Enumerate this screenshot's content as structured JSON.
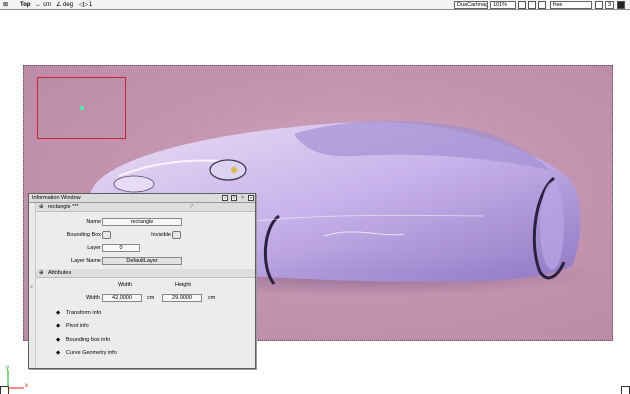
{
  "toolbar": {
    "view_name": "Top",
    "unit": "cm",
    "angle_unit": "deg",
    "snap_value": "1",
    "image_name": "DuaCarImage",
    "zoom": "101%",
    "mode": "free",
    "page_count": "3"
  },
  "info_window": {
    "title": "Information Window",
    "object_header": "rectangle ***",
    "name_label": "Name",
    "name_value": "rectangle",
    "bbox_label": "Bounding Box",
    "invisible_label": "Invisible",
    "layer_label": "Layer",
    "layer_value": "0",
    "layer_name_label": "Layer Name",
    "layer_name_value": "DefaultLayer",
    "attributes_header": "Attributes",
    "width_col": "Width",
    "height_col": "Height",
    "width_label": "Width",
    "width_value": "42.0000",
    "width_unit": "cm",
    "height_value": "29.0000",
    "height_unit": "cm",
    "sub_sections": [
      "Transform info",
      "Pivot info",
      "Bounding box info",
      "Curve Geometry info"
    ]
  },
  "axis": {
    "y_label": "y",
    "x_label": "x"
  },
  "colors": {
    "canvas_bg": "#c295b0",
    "selection": "#d02040",
    "pivot": "#40ffa0"
  }
}
